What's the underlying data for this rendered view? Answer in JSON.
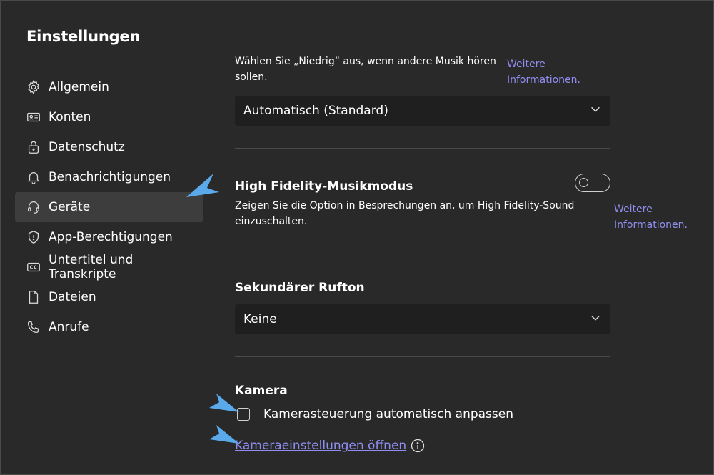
{
  "title": "Einstellungen",
  "nav": [
    {
      "label": "Allgemein",
      "icon": "gear-icon",
      "active": false
    },
    {
      "label": "Konten",
      "icon": "id-card-icon",
      "active": false
    },
    {
      "label": "Datenschutz",
      "icon": "lock-icon",
      "active": false
    },
    {
      "label": "Benachrichtigungen",
      "icon": "bell-icon",
      "active": false
    },
    {
      "label": "Geräte",
      "icon": "headset-icon",
      "active": true
    },
    {
      "label": "App-Berechtigungen",
      "icon": "shield-icon",
      "active": false
    },
    {
      "label": "Untertitel und Transkripte",
      "icon": "cc-icon",
      "active": false
    },
    {
      "label": "Dateien",
      "icon": "file-icon",
      "active": false
    },
    {
      "label": "Anrufe",
      "icon": "phone-icon",
      "active": false
    }
  ],
  "music": {
    "description": "Wählen Sie „Niedrig“ aus, wenn andere Musik hören sollen.",
    "more_info": "Weitere Informationen.",
    "dropdown_value": "Automatisch (Standard)"
  },
  "hifi": {
    "title": "High Fidelity-Musikmodus",
    "description": "Zeigen Sie die Option in Besprechungen an, um High Fidelity-Sound einzuschalten.",
    "more_info": "Weitere Informationen.",
    "toggle_on": false
  },
  "ringtone": {
    "title": "Sekundärer Rufton",
    "dropdown_value": "Keine"
  },
  "camera": {
    "title": "Kamera",
    "checkbox_label": "Kamerasteuerung automatisch anpassen",
    "checkbox_checked": false,
    "settings_link": "Kameraeinstellungen öffnen"
  },
  "colors": {
    "background": "#292929",
    "link": "#8f8ef0",
    "annotation_arrow": "#5aa9ea"
  }
}
